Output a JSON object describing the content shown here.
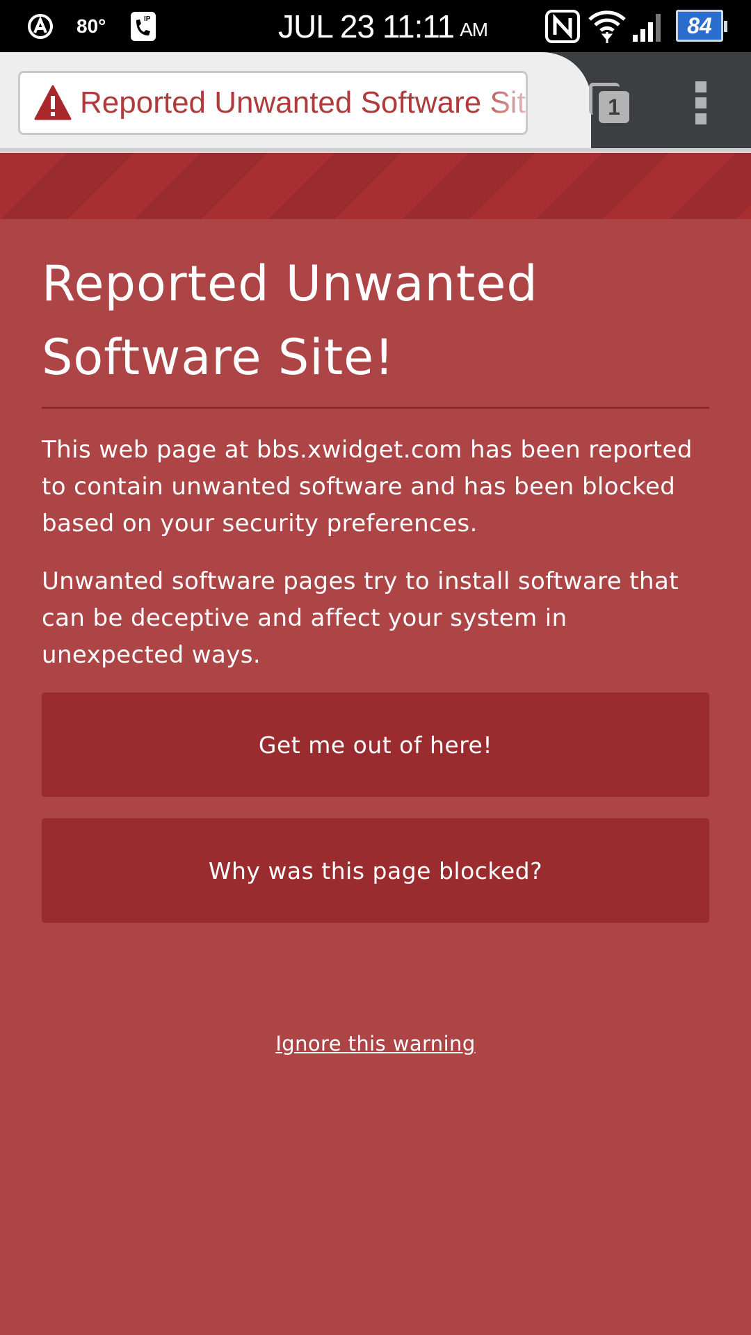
{
  "status_bar": {
    "temperature": "80°",
    "date_time": "JUL 23 11:11",
    "ampm": "AM",
    "battery_level": "84",
    "icons": [
      "app-a-icon",
      "phone-ip-icon",
      "nfc-icon",
      "wifi-icon",
      "signal-icon",
      "battery-icon"
    ]
  },
  "browser": {
    "url_bar_text": "Reported Unwanted Software Site!",
    "tab_count": "1",
    "icons": [
      "warning-icon",
      "tabs-icon",
      "overflow-menu-icon"
    ]
  },
  "page": {
    "title": "Reported Unwanted Software Site!",
    "paragraph_1": "This web page at bbs.xwidget.com has been reported to contain unwanted software and has been blocked based on your security preferences.",
    "paragraph_2": "Unwanted software pages try to install software that can be deceptive and affect your system in unexpected ways.",
    "button_primary": "Get me out of here!",
    "button_secondary": "Why was this page blocked?",
    "ignore_link": "Ignore this warning"
  },
  "colors": {
    "background": "#ad4446",
    "button": "#9a2c2f",
    "stripe_dark": "#9b2b2e",
    "stripe_light": "#a72f32",
    "url_text": "#b13a3c"
  }
}
